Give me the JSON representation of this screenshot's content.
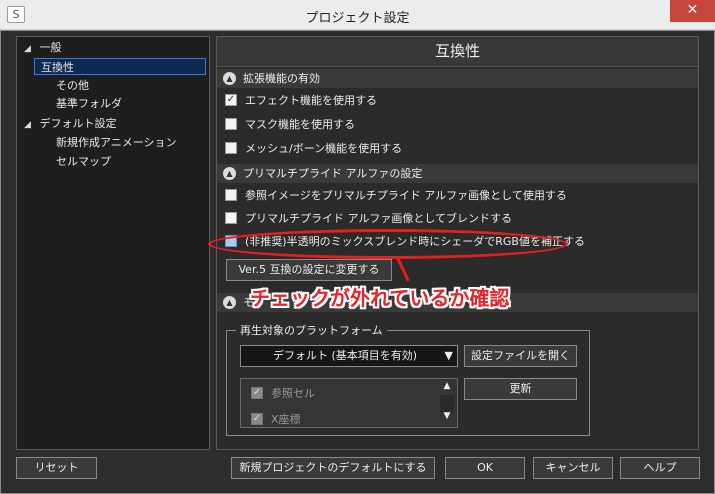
{
  "window": {
    "app_icon": "S",
    "title": "プロジェクト設定",
    "close": "✕"
  },
  "tree": {
    "items": [
      {
        "label": "一般",
        "arrow": "◢",
        "level": 0
      },
      {
        "label": "互換性",
        "level": 1,
        "selected": true
      },
      {
        "label": "その他",
        "level": 1
      },
      {
        "label": "基準フォルダ",
        "level": 1
      },
      {
        "label": "デフォルト設定",
        "arrow": "◢",
        "level": 0
      },
      {
        "label": "新規作成アニメーション",
        "level": 1
      },
      {
        "label": "セルマップ",
        "level": 1
      }
    ]
  },
  "panel": {
    "title": "互換性",
    "section1": {
      "title": "拡張機能の有効",
      "options": [
        {
          "label": "エフェクト機能を使用する",
          "checked": true
        },
        {
          "label": "マスク機能を使用する",
          "checked": false
        },
        {
          "label": "メッシュ/ボーン機能を使用する",
          "checked": false
        }
      ]
    },
    "section2": {
      "title": "プリマルチプライド アルファの設定",
      "options": [
        {
          "label": "参照イメージをプリマルチプライド アルファ画像として使用する",
          "checked": false
        },
        {
          "label": "プリマルチプライド アルファ画像としてブレンドする",
          "checked": false
        },
        {
          "label": "(非推奨)半透明のミックスブレンド時にシェーダでRGB値を補正する",
          "checked": false
        }
      ],
      "ver5_button": "Ver.5 互換の設定に変更する"
    },
    "section3": {
      "title": "モ"
    },
    "platform": {
      "group_label": "再生対象のプラットフォーム",
      "dropdown_value": "デフォルト (基本項目を有効)",
      "dropdown_arrow": "▼",
      "open_settings_button": "設定ファイルを開く",
      "update_button": "更新",
      "list": [
        {
          "label": "参照セル",
          "checked": true
        },
        {
          "label": "X座標",
          "checked": true
        }
      ],
      "scroll_up": "▲",
      "scroll_down": "▼"
    }
  },
  "annotation": "チェックが外れているか確認",
  "annotation_color": "#e4252a",
  "footer": {
    "reset": "リセット",
    "set_default": "新規プロジェクトのデフォルトにする",
    "ok": "OK",
    "cancel": "キャンセル",
    "help": "ヘルプ"
  }
}
